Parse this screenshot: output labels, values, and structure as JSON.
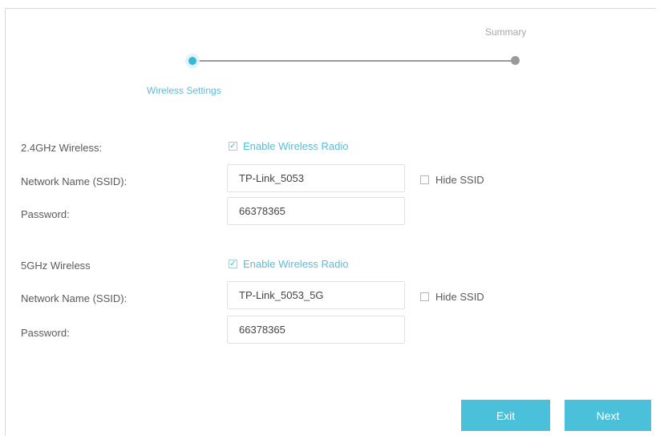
{
  "stepper": {
    "steps": [
      {
        "label": "Wireless Settings",
        "state": "active"
      },
      {
        "label": "Summary",
        "state": "pending"
      }
    ]
  },
  "wireless_24": {
    "section_label": "2.4GHz Wireless:",
    "enable_label": "Enable Wireless Radio",
    "enable_checked": true,
    "ssid_label": "Network Name (SSID):",
    "ssid_value": "TP-Link_5053",
    "hide_ssid_label": "Hide SSID",
    "hide_ssid_checked": false,
    "password_label": "Password:",
    "password_value": "66378365"
  },
  "wireless_5": {
    "section_label": "5GHz Wireless",
    "enable_label": "Enable Wireless Radio",
    "enable_checked": true,
    "ssid_label": "Network Name (SSID):",
    "ssid_value": "TP-Link_5053_5G",
    "hide_ssid_label": "Hide SSID",
    "hide_ssid_checked": false,
    "password_label": "Password:",
    "password_value": "66378365"
  },
  "buttons": {
    "exit_label": "Exit",
    "next_label": "Next"
  },
  "colors": {
    "accent": "#4ac0db",
    "accent_text": "#5bbcd6",
    "step_line": "#9a9a9a",
    "label_text": "#5a5a5a"
  },
  "icons": {
    "checked": "checkbox-checked-icon",
    "unchecked": "checkbox-unchecked-icon"
  }
}
